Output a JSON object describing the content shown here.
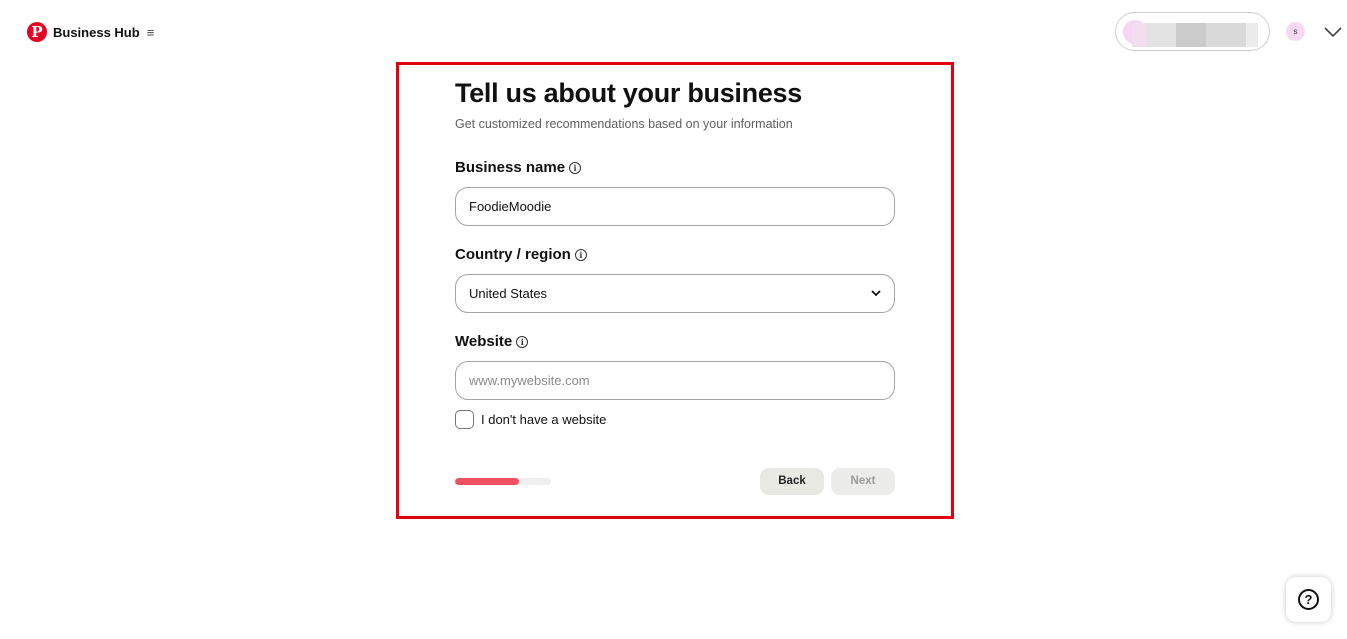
{
  "header": {
    "logo_glyph": "P",
    "brand_title": "Business Hub",
    "menu_glyph": "≡",
    "user_initial": "s"
  },
  "form": {
    "title": "Tell us about your business",
    "subtitle": "Get customized recommendations based on your information",
    "business_name": {
      "label": "Business name",
      "value": "FoodieMoodie"
    },
    "country": {
      "label": "Country / region",
      "value": "United States"
    },
    "website": {
      "label": "Website",
      "value": "",
      "placeholder": "www.mywebsite.com"
    },
    "no_website": {
      "label": "I don't have a website",
      "checked": false
    },
    "progress_fraction": 0.67,
    "back_label": "Back",
    "next_label": "Next",
    "info_glyph": "i"
  },
  "help": {
    "glyph": "?"
  },
  "colors": {
    "brand_red": "#e60023",
    "highlight_border": "#e3000f",
    "progress_fill": "#f05060",
    "button_bg": "#e9e9e4"
  }
}
